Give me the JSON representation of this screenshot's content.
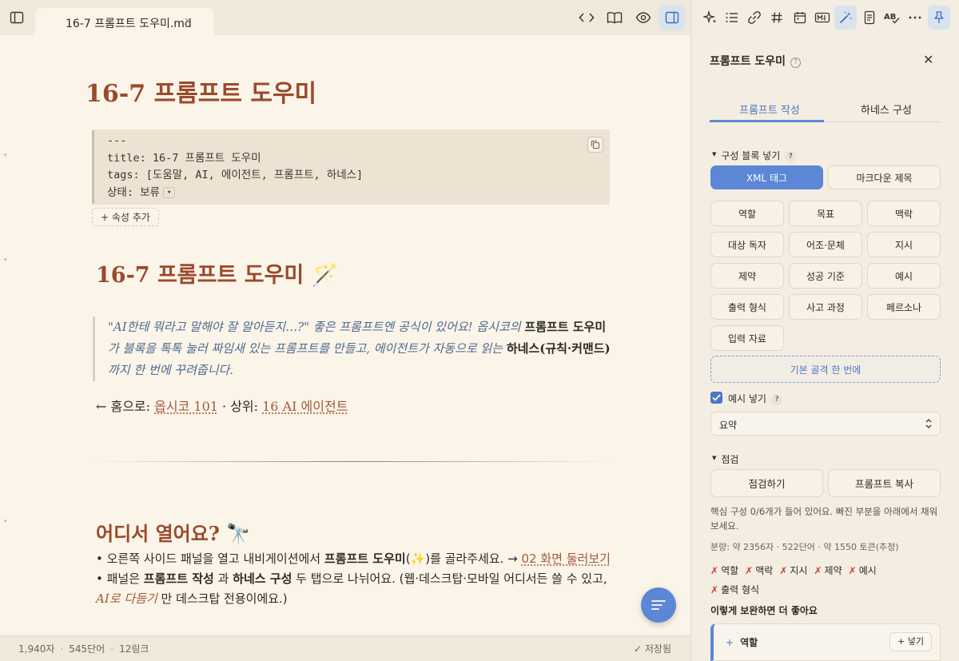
{
  "tab": {
    "title": "16-7 프롬프트 도우미.md",
    "close": "×"
  },
  "doc": {
    "title": "16-7 프롬프트 도우미",
    "frontmatter": [
      "---",
      "title: 16-7 프롬프트 도우미",
      "tags: [도움말, AI, 에이전트, 프롬프트, 하네스]"
    ],
    "status_key": "상태: 보류",
    "add_property": "+ 속성 추가",
    "h1": "16-7 프롬프트 도우미",
    "h1_emoji": "🪄",
    "quote": {
      "p1": "\"AI한테 뭐라고 말해야 잘 알아듣지…?\" 좋은 프롬프트엔 공식이 있어요! 옵시코의 ",
      "b1": "프롬프트 도우미",
      "p2": "가 블록을 톡톡 눌러 짜임새 있는 프롬프트를 만들고, 에이전트가 자동으로 읽는 ",
      "b2": "하네스(규칙·커맨드)",
      "p3": " 까지 한 번에 꾸려줍니다."
    },
    "nav": {
      "prefix": "← 홈으로: ",
      "home": "옵시코 101",
      "mid": " · 상위: ",
      "parent": "16 AI 에이전트"
    },
    "h2": "어디서 열어요?",
    "h2_emoji": "🔭",
    "bullet1": {
      "a": "• 오른쪽 사이드 패널을 열고 내비게이션에서 ",
      "b": "프롬프트 도우미",
      "c": "(✨)를 골라주세요. → ",
      "link": "02 화면 둘러보기"
    },
    "bullet2": {
      "a": "• 패널은 ",
      "b": "프롬프트 작성",
      "c": " 과 ",
      "d": "하네스 구성",
      "e": " 두 탭으로 나뉘어요. (웹·데스크탑·모바일 어디서든 쓸 수 있고, ",
      "f": "AI로 다듬기",
      "g": " 만 데스크탑 전용이에요.)"
    }
  },
  "status": {
    "chars": "1,940자",
    "words": "545단어",
    "links": "12링크",
    "saved": "✓ 저장됨"
  },
  "panel": {
    "title": "프롬프트 도우미",
    "help": "?",
    "close": "✕",
    "tabs": [
      "프롬프트 작성",
      "하네스 구성"
    ],
    "section_blocks": "구성 블록 넣기",
    "format_buttons": [
      "XML 태그",
      "마크다운 제목"
    ],
    "chips": [
      "역할",
      "목표",
      "맥락",
      "대상 독자",
      "어조·문체",
      "지시",
      "제약",
      "성공 기준",
      "예시",
      "출력 형식",
      "사고 과정",
      "페르소나",
      "입력 자료"
    ],
    "skeleton_button": "기본 골격 한 번에",
    "example_checkbox": "예시 넣기",
    "select_value": "요약",
    "section_check": "점검",
    "check_buttons": [
      "점검하기",
      "프롬프트 복사"
    ],
    "check_msg": "핵심 구성 0/6개가 들어 있어요. 빠진 부분을 아래에서 채워보세요.",
    "volume": "분량: 약 2356자 · 522단어 · 약 1550 토큰(추정)",
    "missing": [
      "역할",
      "맥락",
      "지시",
      "제약",
      "예시",
      "출력 형식"
    ],
    "missing_mark": "✗",
    "suggest_title": "이렇게 보완하면 더 좋아요",
    "suggest_item": "역할",
    "suggest_btn": "+ 넣기"
  },
  "colors": {
    "accent": "#5b87d6",
    "heading": "#9a4a2c",
    "link": "#a3593c",
    "quote": "#4d6a8f",
    "missing": "#c9402b"
  }
}
